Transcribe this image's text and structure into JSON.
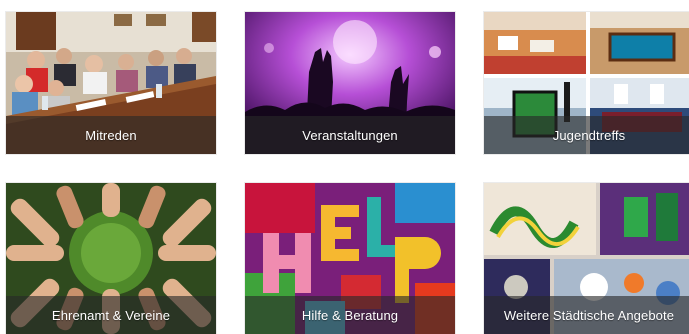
{
  "tiles": [
    {
      "label": "Mitreden",
      "image": "council-meeting-photo"
    },
    {
      "label": "Veranstaltungen",
      "image": "concert-crowd-photo"
    },
    {
      "label": "Jugendtreffs",
      "image": "youth-center-collage"
    },
    {
      "label": "Ehrenamt & Vereine",
      "image": "hands-circle-photo"
    },
    {
      "label": "Hilfe & Beratung",
      "image": "help-letters-photo"
    },
    {
      "label": "Weitere Städtische Angebote",
      "image": "graffiti-wall-photo"
    }
  ]
}
